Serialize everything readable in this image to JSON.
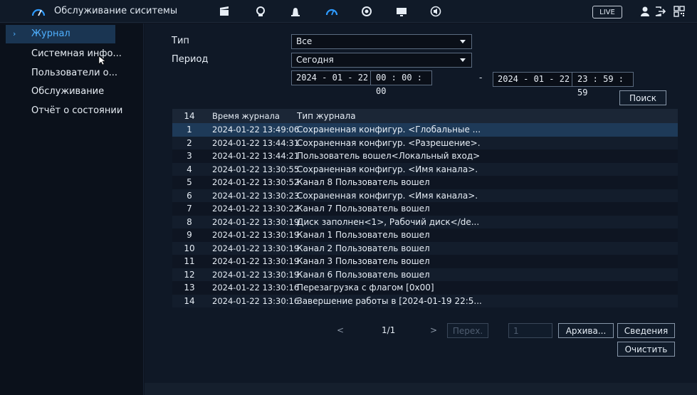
{
  "header": {
    "title": "Обслуживание сиситемы",
    "live_label": "LIVE",
    "icons": [
      "dashboard-icon",
      "clapper-icon",
      "face-icon",
      "alarm-icon",
      "maintenance-icon",
      "camera-icon",
      "monitor-icon",
      "audio-icon",
      "user-icon",
      "logout-icon",
      "qr-icon"
    ]
  },
  "sidebar": {
    "items": [
      {
        "label": "Журнал",
        "active": true
      },
      {
        "label": "Системная инфо..."
      },
      {
        "label": "Пользователи о..."
      },
      {
        "label": "Обслуживание"
      },
      {
        "label": "Отчёт о состоянии"
      }
    ]
  },
  "filters": {
    "type_label": "Тип",
    "type_value": "Все",
    "period_label": "Период",
    "period_value": "Сегодня",
    "start_date": "2024 - 01 - 22",
    "start_time": "00 : 00 : 00",
    "range_sep": "-",
    "end_date": "2024 - 01 - 22",
    "end_time": "23 : 59 : 59",
    "search_label": "Поиск"
  },
  "table": {
    "headers": {
      "no": "14",
      "time": "Время журнала",
      "type": "Тип журнала"
    },
    "rows": [
      {
        "no": "1",
        "time": "2024-01-22 13:49:06",
        "type": "Сохраненная конфигур. <Глобальные ..."
      },
      {
        "no": "2",
        "time": "2024-01-22 13:44:31",
        "type": "Сохраненная конфигур. <Разрешение>."
      },
      {
        "no": "3",
        "time": "2024-01-22 13:44:21",
        "type": "Пользователь вошел<Локальный вход>"
      },
      {
        "no": "4",
        "time": "2024-01-22 13:30:55",
        "type": "Сохраненная конфигур. <Имя канала>."
      },
      {
        "no": "5",
        "time": "2024-01-22 13:30:52",
        "type": "Канал 8 Пользователь вошел"
      },
      {
        "no": "6",
        "time": "2024-01-22 13:30:23",
        "type": "Сохраненная конфигур. <Имя канала>."
      },
      {
        "no": "7",
        "time": "2024-01-22 13:30:22",
        "type": "Канал 7 Пользователь вошел"
      },
      {
        "no": "8",
        "time": "2024-01-22 13:30:19",
        "type": "Диск заполнен<1>, Рабочий диск</de..."
      },
      {
        "no": "9",
        "time": "2024-01-22 13:30:19",
        "type": "Канал 1 Пользователь вошел"
      },
      {
        "no": "10",
        "time": "2024-01-22 13:30:19",
        "type": "Канал 2 Пользователь вошел"
      },
      {
        "no": "11",
        "time": "2024-01-22 13:30:19",
        "type": "Канал 3 Пользователь вошел"
      },
      {
        "no": "12",
        "time": "2024-01-22 13:30:19",
        "type": "Канал 6 Пользователь вошел"
      },
      {
        "no": "13",
        "time": "2024-01-22 13:30:16",
        "type": "Перезагрузка с флагом [0x00]"
      },
      {
        "no": "14",
        "time": "2024-01-22 13:30:16",
        "type": "Завершение работы в [2024-01-19 22:5..."
      }
    ]
  },
  "pager": {
    "prev": "<",
    "page": "1/1",
    "next": ">",
    "go_label": "Перех.",
    "page_input": "1",
    "archive_label": "Архива...",
    "details_label": "Сведения",
    "clear_label": "Очистить"
  },
  "colors": {
    "accent": "#4fb0ff",
    "selected_row": "#1e3a58",
    "background": "#0f1826"
  }
}
